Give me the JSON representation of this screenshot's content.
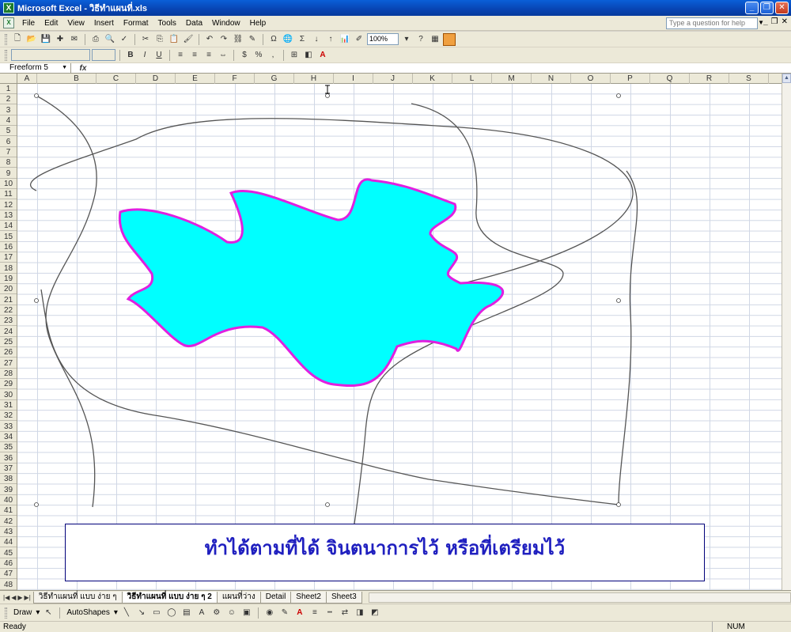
{
  "window": {
    "title": "Microsoft Excel - วิธีทำแผนที่.xls"
  },
  "menu": [
    "File",
    "Edit",
    "View",
    "Insert",
    "Format",
    "Tools",
    "Data",
    "Window",
    "Help"
  ],
  "help_placeholder": "Type a question for help",
  "toolbar": {
    "zoom": "100%"
  },
  "formula_bar": {
    "name_box": "Freeform 5",
    "fx": "fx"
  },
  "columns": [
    "A",
    "B",
    "C",
    "D",
    "E",
    "F",
    "G",
    "H",
    "I",
    "J",
    "K",
    "L",
    "M",
    "N",
    "O",
    "P",
    "Q",
    "R",
    "S"
  ],
  "rows": [
    "1",
    "2",
    "3",
    "4",
    "5",
    "6",
    "7",
    "8",
    "9",
    "10",
    "11",
    "12",
    "13",
    "14",
    "15",
    "16",
    "17",
    "18",
    "19",
    "20",
    "21",
    "22",
    "23",
    "24",
    "25",
    "26",
    "27",
    "28",
    "29",
    "30",
    "31",
    "32",
    "33",
    "34",
    "35",
    "36",
    "37",
    "38",
    "39",
    "40",
    "41",
    "42",
    "43",
    "44",
    "45",
    "46",
    "47",
    "48"
  ],
  "textbox": {
    "text": "ทำได้ตามที่ได้ จินตนาการไว้ หรือที่เตรียมไว้",
    "color": "#1f1fbf"
  },
  "shape": {
    "fill": "#00ffff",
    "stroke": "#e020e0"
  },
  "sheet_tabs": [
    {
      "label": "วิธีทำแผนที่ แบบ ง่าย ๆ",
      "active": false
    },
    {
      "label": "วิธีทำแผนที่ แบบ ง่าย ๆ 2",
      "active": true
    },
    {
      "label": "แผนที่ว่าง",
      "active": false
    },
    {
      "label": "Detail",
      "active": false
    },
    {
      "label": "Sheet2",
      "active": false
    },
    {
      "label": "Sheet3",
      "active": false
    }
  ],
  "drawing": {
    "draw": "Draw",
    "autoshapes": "AutoShapes"
  },
  "status": {
    "left": "Ready",
    "num": "NUM"
  }
}
